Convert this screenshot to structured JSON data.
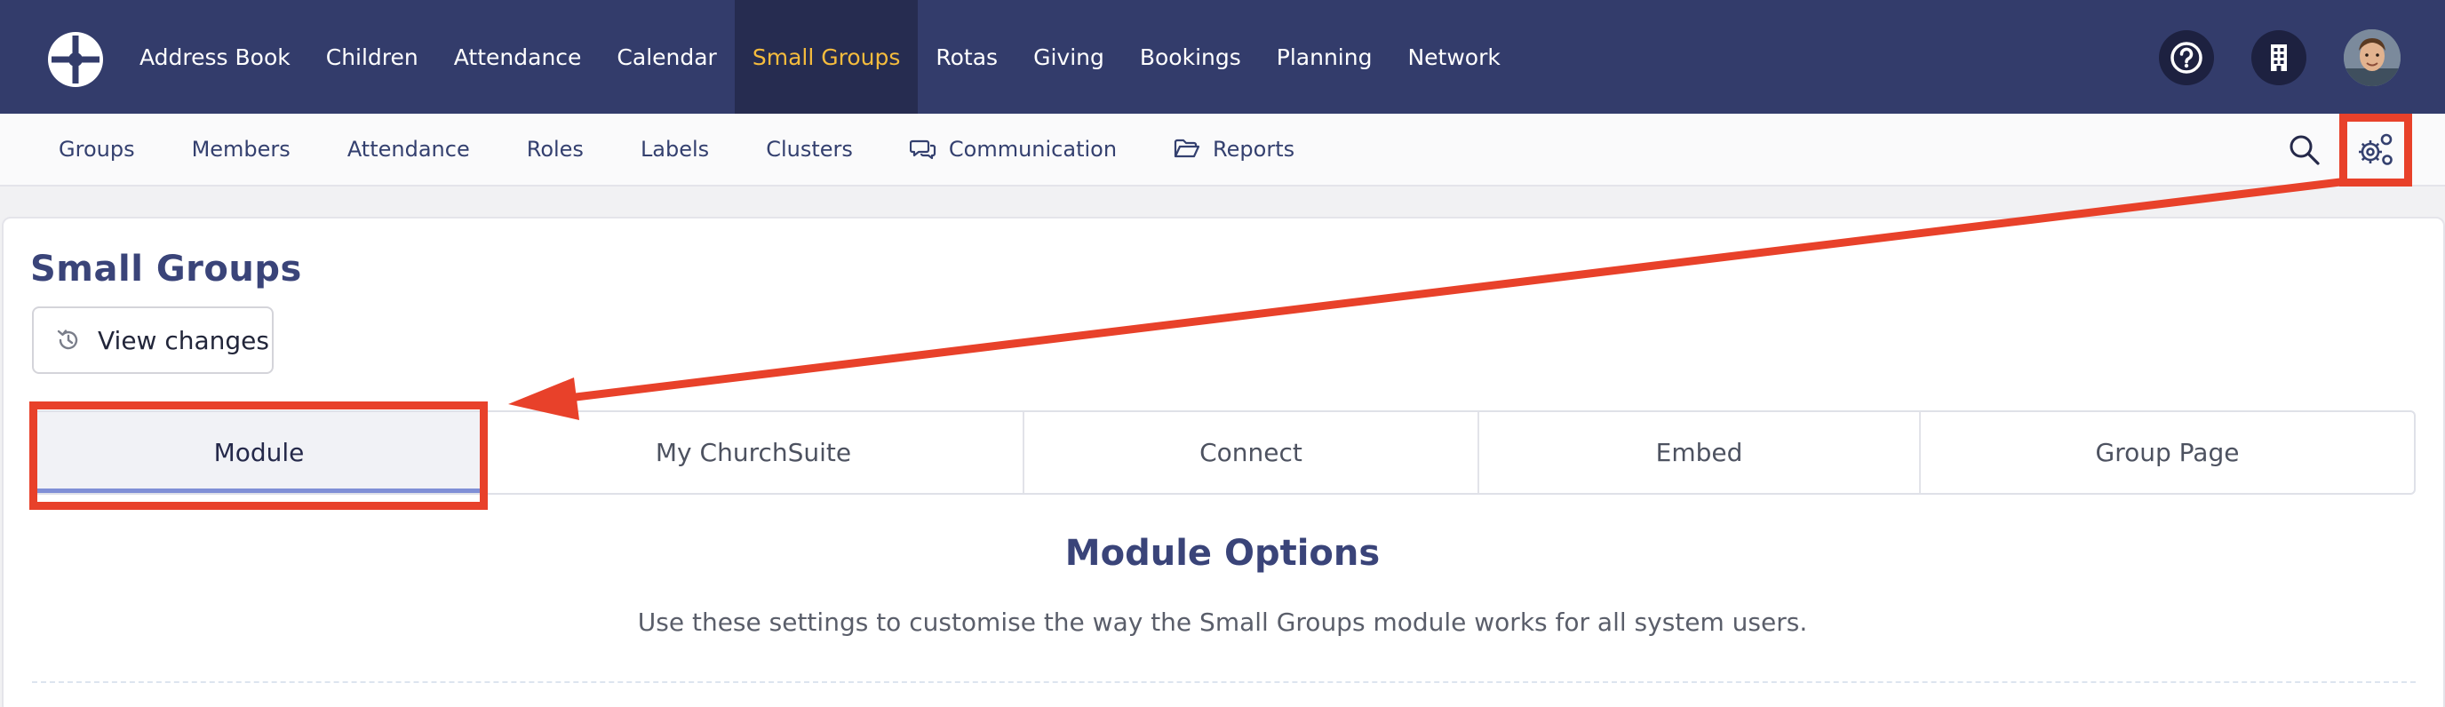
{
  "topnav": {
    "items": [
      {
        "label": "Address Book"
      },
      {
        "label": "Children"
      },
      {
        "label": "Attendance"
      },
      {
        "label": "Calendar"
      },
      {
        "label": "Small Groups"
      },
      {
        "label": "Rotas"
      },
      {
        "label": "Giving"
      },
      {
        "label": "Bookings"
      },
      {
        "label": "Planning"
      },
      {
        "label": "Network"
      }
    ],
    "active_index": 4,
    "icons": [
      "help-icon",
      "building-icon"
    ]
  },
  "subnav": {
    "items": [
      {
        "label": "Groups"
      },
      {
        "label": "Members"
      },
      {
        "label": "Attendance"
      },
      {
        "label": "Roles"
      },
      {
        "label": "Labels"
      },
      {
        "label": "Clusters"
      },
      {
        "label": "Communication",
        "icon": "chat-icon"
      },
      {
        "label": "Reports",
        "icon": "folder-open-icon"
      }
    ],
    "icons": [
      "search-icon",
      "settings-gears-icon"
    ]
  },
  "page": {
    "title": "Small Groups",
    "view_changes_label": "View changes"
  },
  "tabs": [
    {
      "label": "Module",
      "active": true
    },
    {
      "label": "My ChurchSuite",
      "active": false
    },
    {
      "label": "Connect",
      "active": false
    },
    {
      "label": "Embed",
      "active": false
    },
    {
      "label": "Group Page",
      "active": false
    }
  ],
  "options": {
    "title": "Module Options",
    "description": "Use these settings to customise the way the Small Groups module works for all system users."
  },
  "colors": {
    "topnav_bg": "#333c6b",
    "active_nav_bg": "#262c50",
    "active_nav_text": "#f5bc3d",
    "accent": "#3a4479",
    "tab_underline": "#7f8fd6",
    "annotation": "#e8412a"
  }
}
